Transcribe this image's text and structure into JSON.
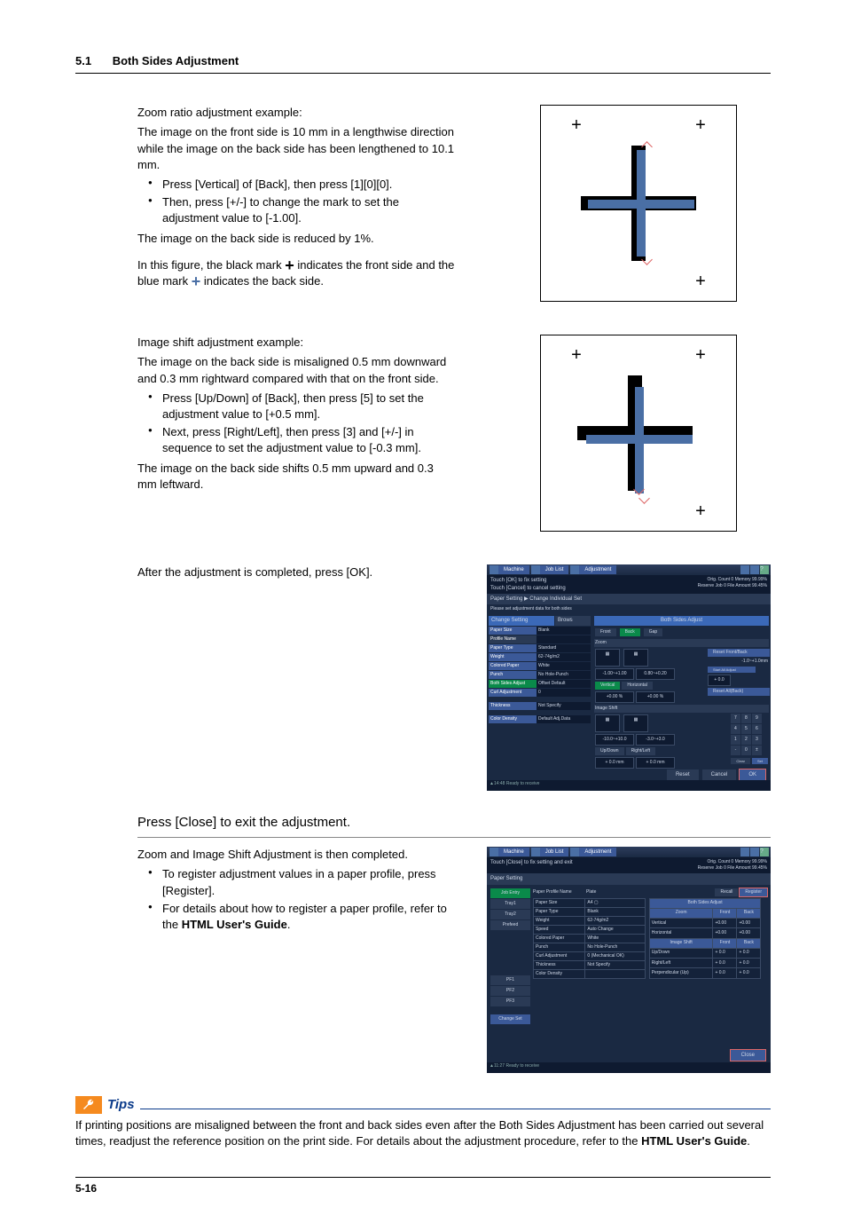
{
  "header": {
    "section_num": "5.1",
    "section_title": "Both Sides Adjustment"
  },
  "block1": {
    "p1": "Zoom ratio adjustment example:",
    "p2": "The image on the front side is 10 mm in a lengthwise direction while the image on the back side has been lengthened to 10.1 mm.",
    "li1": "Press [Vertical] of [Back], then press [1][0][0].",
    "li2": "Then, press [+/-] to change the mark to set the adjustment value to [-1.00].",
    "p3": "The image on the back side is reduced by 1%.",
    "p4a": "In this figure, the black mark ",
    "p4b": " indicates the front side and the blue mark ",
    "p4c": " indicates the back side."
  },
  "block2": {
    "p1": "Image shift adjustment example:",
    "p2": "The image on the back side is misaligned 0.5 mm downward and 0.3 mm rightward compared with that on the front side.",
    "li1": "Press [Up/Down] of [Back], then press [5] to set the adjustment value to [+0.5 mm].",
    "li2": "Next, press [Right/Left], then press [3] and [+/-] in sequence to set the adjustment value to [-0.3 mm].",
    "p3": "The image on the back side shifts 0.5 mm upward and 0.3 mm leftward."
  },
  "block3": {
    "p1": "After the adjustment is completed, press [OK]."
  },
  "step2": {
    "heading": "Press [Close] to exit the adjustment.",
    "p1": "Zoom and Image Shift Adjustment is then completed.",
    "li1": "To register adjustment values in a paper profile, press [Register].",
    "li2a": "For details about how to register a paper profile, refer to the ",
    "li2b": "HTML User's Guide",
    "li2c": "."
  },
  "tips": {
    "label": "Tips",
    "text_a": "If printing positions are misaligned between the front and back sides even after the Both Sides Adjustment has been carried out several times, readjust the reference position on the print side. For details about the adjustment procedure, refer to the ",
    "text_b": "HTML User's Guide",
    "text_c": "."
  },
  "footer": {
    "page": "5-16"
  },
  "screenshot1": {
    "topbar": {
      "machine": "Machine",
      "joblist": "Job List",
      "adjust": "Adjustment",
      "icon_help": "?"
    },
    "info1": "Touch [OK] to fix setting",
    "info2": "Touch [Cancel] to cancel setting",
    "status": {
      "orig": "Orig. Count",
      "orig_v": "0",
      "mem": "Memory",
      "mem_v": "99.99%",
      "res": "Reserve Job",
      "res_v": "0",
      "file": "File Amount",
      "file_v": "99.45%"
    },
    "breadcrumb": "Paper Setting    ▶ Change Individual Set",
    "instr": "Please set adjustment data for both sides",
    "left": {
      "hdr1": "Change Setting",
      "hdr2": "Brows",
      "rows": {
        "paper_size": "Paper Size",
        "paper_size_v": "Blank",
        "profile": "Profile Name",
        "profile_v": "",
        "paper_type": "Paper Type",
        "paper_type_v": "Standard",
        "weight": "Weight",
        "weight_v": "62-74g/m2",
        "colored": "Colored Paper",
        "colored_v": "White",
        "punch": "Punch",
        "punch_v": "No Hole-Punch",
        "both": "Both Sides Adjust",
        "both_v": "Offset Default",
        "curl": "Curl Adjustment",
        "curl_v": "0",
        "thick": "Thickness",
        "thick_v": "Not Specify",
        "color": "Color Density",
        "color_v": "Default Adj.Data"
      }
    },
    "right": {
      "hdr": "Both Sides Adjust",
      "front": "Front",
      "back": "Back",
      "gap": "Gap",
      "zoom": "Zoom",
      "reset": "Reset Front/Back",
      "range_zoom": "-1.0~+1.0mm",
      "vert": "Vertical",
      "horiz": "Horizontal",
      "zoom_v1": "-1.00~+1.00",
      "zoom_v2": "0.80~+0.20",
      "start": "Start All Adjust",
      "start_v": "+ 0.0",
      "reset_back": "Reset All(Back)",
      "zoom_val1": "+0.00 %",
      "zoom_val2": "+0.00 %",
      "imgshift": "Image Shift",
      "range_shift": "-10.0~+10.0",
      "range_shift2": "-3.0~+3.0",
      "updown": "Up/Down",
      "rightleft": "Right/Left",
      "shift_v1": "+ 0.0 mm",
      "shift_v2": "+ 0.0 mm",
      "clear": "Clear",
      "set": "Set",
      "keys": [
        "7",
        "8",
        "9",
        "4",
        "5",
        "6",
        "1",
        "2",
        "3",
        "-",
        "0",
        "±"
      ],
      "reset_b": "Reset",
      "cancel": "Cancel",
      "ok": "OK"
    },
    "footer": "▲14:48  Ready to receive"
  },
  "screenshot2": {
    "topbar": {
      "machine": "Machine",
      "joblist": "Job List",
      "adjust": "Adjustment"
    },
    "info1": "Touch [Close] to fix setting and exit",
    "status": {
      "orig": "Orig. Count",
      "orig_v": "0",
      "mem": "Memory",
      "mem_v": "99.99%",
      "res": "Reserve Job",
      "res_v": "0",
      "file": "File Amount",
      "file_v": "99.45%"
    },
    "breadcrumb": "Paper Setting",
    "tabs": {
      "t1": "Job Entry",
      "t2": "Tray1",
      "t3": "Tray2",
      "t4": "Prefeed"
    },
    "profile": {
      "lbl": "Paper Profile Name",
      "val": "Plate",
      "recall": "Recall",
      "register": "Register"
    },
    "left_tbl": {
      "r": {
        "size": "Paper Size",
        "size_v": "A4 ▢",
        "type": "Paper Type",
        "type_v": "Blank",
        "weight": "Weight",
        "weight_v": "62-74g/m2",
        "speed": "Speed",
        "speed_v": "Auto Change",
        "colored": "Colored Paper",
        "colored_v": "White",
        "punch": "Punch",
        "punch_v": "No Hole-Punch",
        "curl": "Curl Adjustment",
        "curl_v": "0 (Mechanical OK)",
        "thick": "Thickness",
        "thick_v": "Not Specify",
        "color": "Color Density",
        "color_v": ""
      }
    },
    "right_tbl": {
      "hdr": "Both Sides Adjust",
      "zoom": "Zoom",
      "front": "Front",
      "back": "Back",
      "vert": "Vertical",
      "vert_f": "+0.00",
      "vert_b": "+0.00",
      "horiz": "Horizontal",
      "horiz_f": "+0.00",
      "horiz_b": "+0.00",
      "shift": "Image Shift",
      "ud": "Up/Down",
      "ud_f": "+ 0.0",
      "ud_b": "+ 0.0",
      "rl": "Right/Left",
      "rl_f": "+ 0.0",
      "rl_b": "+ 0.0",
      "perp": "Perpendicular (Up)",
      "perp_f": "+ 0.0",
      "perp_b": "+ 0.0"
    },
    "pf": {
      "p1": "PF1",
      "p2": "PF2",
      "p3": "PF3"
    },
    "change": "Change Set",
    "close": "Close",
    "footer": "▲11:27  Ready to receive"
  }
}
